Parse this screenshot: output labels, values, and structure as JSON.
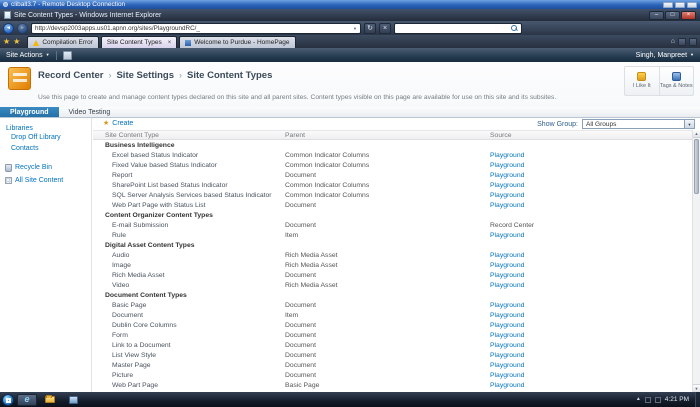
{
  "rdp_bar": {
    "title": "cliball3.7 - Remote Desktop Connection"
  },
  "browser": {
    "window_title": "Site Content Types - Windows Internet Explorer",
    "address_url": "http://devsp2003apps.us01.apnn.org/sites/PlaygroundRC/_",
    "search_value": "",
    "tabs": [
      {
        "label": "Compilation Error"
      },
      {
        "label": "Site Content Types"
      },
      {
        "label": "Welcome to Purdue - HomePage"
      }
    ]
  },
  "sp_chrome": {
    "site_actions": "Site Actions",
    "user_name": "Singh, Manpreet"
  },
  "header": {
    "breadcrumb": {
      "site": "Record Center",
      "section": "Site Settings",
      "page": "Site Content Types",
      "separator": "›"
    },
    "description": "Use this page to create and manage content types declared on this site and all parent sites. Content types visible on this page are available for use on this site and its subsites.",
    "like_label": "I Like It",
    "tags_label": "Tags & Notes"
  },
  "site_tabs": {
    "active": "Playground",
    "other": "Video Testing"
  },
  "sidebar": {
    "libraries_header": "Libraries",
    "items": [
      "Drop Off Library",
      "Contacts"
    ],
    "recycle_bin": "Recycle Bin",
    "all_site_content": "All Site Content"
  },
  "toolbar": {
    "create": "Create",
    "show_group_label": "Show Group:",
    "show_group_value": "All Groups"
  },
  "table": {
    "columns": [
      "Site Content Type",
      "Parent",
      "Source"
    ],
    "groups": [
      {
        "name": "Business Intelligence",
        "rows": [
          {
            "name": "Excel based Status Indicator",
            "parent": "Common Indicator Columns",
            "source": "Playground",
            "source_link": true
          },
          {
            "name": "Fixed Value based Status Indicator",
            "parent": "Common Indicator Columns",
            "source": "Playground",
            "source_link": true
          },
          {
            "name": "Report",
            "parent": "Document",
            "source": "Playground",
            "source_link": true
          },
          {
            "name": "SharePoint List based Status Indicator",
            "parent": "Common Indicator Columns",
            "source": "Playground",
            "source_link": true
          },
          {
            "name": "SQL Server Analysis Services based Status Indicator",
            "parent": "Common Indicator Columns",
            "source": "Playground",
            "source_link": true
          },
          {
            "name": "Web Part Page with Status List",
            "parent": "Document",
            "source": "Playground",
            "source_link": true
          }
        ]
      },
      {
        "name": "Content Organizer Content Types",
        "rows": [
          {
            "name": "E-mail Submission",
            "parent": "Document",
            "source": "Record Center",
            "source_link": false,
            "name_link": true
          },
          {
            "name": "Rule",
            "parent": "Item",
            "source": "Playground",
            "source_link": true
          }
        ]
      },
      {
        "name": "Digital Asset Content Types",
        "rows": [
          {
            "name": "Audio",
            "parent": "Rich Media Asset",
            "source": "Playground",
            "source_link": true
          },
          {
            "name": "Image",
            "parent": "Rich Media Asset",
            "source": "Playground",
            "source_link": true
          },
          {
            "name": "Rich Media Asset",
            "parent": "Document",
            "source": "Playground",
            "source_link": true
          },
          {
            "name": "Video",
            "parent": "Rich Media Asset",
            "source": "Playground",
            "source_link": true
          }
        ]
      },
      {
        "name": "Document Content Types",
        "rows": [
          {
            "name": "Basic Page",
            "parent": "Document",
            "source": "Playground",
            "source_link": true
          },
          {
            "name": "Document",
            "parent": "Item",
            "source": "Playground",
            "source_link": true
          },
          {
            "name": "Dublin Core Columns",
            "parent": "Document",
            "source": "Playground",
            "source_link": true
          },
          {
            "name": "Form",
            "parent": "Document",
            "source": "Playground",
            "source_link": true
          },
          {
            "name": "Link to a Document",
            "parent": "Document",
            "source": "Playground",
            "source_link": true
          },
          {
            "name": "List View Style",
            "parent": "Document",
            "source": "Playground",
            "source_link": true
          },
          {
            "name": "Master Page",
            "parent": "Document",
            "source": "Playground",
            "source_link": true
          },
          {
            "name": "Picture",
            "parent": "Document",
            "source": "Playground",
            "source_link": true
          },
          {
            "name": "Web Part Page",
            "parent": "Basic Page",
            "source": "Playground",
            "source_link": true
          }
        ]
      }
    ]
  },
  "taskbar": {
    "time": "4:21 PM"
  },
  "icons": {
    "back": "◄",
    "forward": "►",
    "refresh": "↻",
    "stop": "×",
    "dropdown": "▼",
    "caret_down": "▼",
    "star": "★",
    "close": "×",
    "minimize": "–",
    "maximize": "□",
    "home": "⌂",
    "scroll_up": "▲",
    "scroll_down": "▼",
    "tray_up": "▲",
    "create": "★"
  },
  "colors": {
    "link_blue": "#0072bc",
    "active_site_tab": "#2e7cb4",
    "ribbon_dark": "#21374c",
    "warning_yellow": "#f5b800",
    "site_icon_orange": "#e8941c"
  }
}
